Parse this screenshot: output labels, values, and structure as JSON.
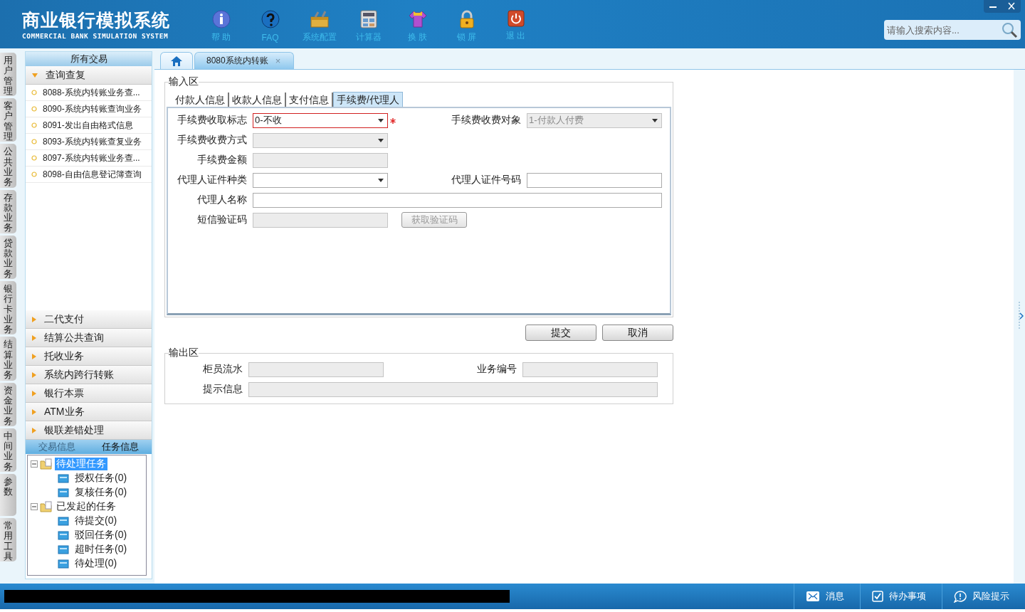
{
  "header": {
    "title": "商业银行模拟系统",
    "subtitle": "COMMERCIAL BANK SIMULATION SYSTEM",
    "nav": [
      {
        "kind": "info",
        "label": "帮 助"
      },
      {
        "kind": "faq",
        "label": "FAQ"
      },
      {
        "kind": "config",
        "label": "系统配置"
      },
      {
        "kind": "calculator",
        "label": "计算器"
      },
      {
        "kind": "skin",
        "label": "换 肤"
      },
      {
        "kind": "lock",
        "label": "锁 屏"
      },
      {
        "kind": "exit",
        "label": "退 出"
      }
    ],
    "search": {
      "placeholder": "请输入搜索内容..."
    }
  },
  "side_tabs": [
    {
      "label": "用户管理",
      "selected": false
    },
    {
      "label": "客户管理",
      "selected": false
    },
    {
      "label": "公共业务",
      "selected": false
    },
    {
      "label": "存款业务",
      "selected": false
    },
    {
      "label": "贷款业务",
      "selected": false
    },
    {
      "label": "银行卡业务",
      "selected": false
    },
    {
      "label": "结算业务",
      "selected": false
    },
    {
      "label": "资金业务",
      "selected": false
    },
    {
      "label": "中间业务",
      "selected": false
    },
    {
      "label": "参数",
      "selected": false
    },
    {
      "label": "常用工具",
      "selected": false
    }
  ],
  "sidebar": {
    "title": "所有交易",
    "groups": [
      {
        "label": "查询查复",
        "expanded": true,
        "items": [
          "8088-系统内转账业务查...",
          "8090-系统内转账查询业务",
          "8091-发出自由格式信息",
          "8093-系统内转账查复业务",
          "8097-系统内转账业务查...",
          "8098-自由信息登记簿查询"
        ]
      },
      {
        "label": "二代支付",
        "expanded": false
      },
      {
        "label": "结算公共查询",
        "expanded": false
      },
      {
        "label": "托收业务",
        "expanded": false
      },
      {
        "label": "系统内跨行转账",
        "expanded": false
      },
      {
        "label": "银行本票",
        "expanded": false
      },
      {
        "label": "ATM业务",
        "expanded": false
      },
      {
        "label": "银联差错处理",
        "expanded": false
      }
    ],
    "tabs": [
      {
        "label": "交易信息",
        "selected": false
      },
      {
        "label": "任务信息",
        "selected": true
      }
    ],
    "tree": [
      {
        "label": "待处理任务",
        "expanded": true,
        "selected": true,
        "children": [
          {
            "label": "授权任务(0)",
            "selected": false
          },
          {
            "label": "复核任务(0)",
            "selected": false
          }
        ]
      },
      {
        "label": "已发起的任务",
        "expanded": true,
        "selected": false,
        "children": [
          {
            "label": "待提交(0)",
            "selected": false
          },
          {
            "label": "驳回任务(0)",
            "selected": false
          },
          {
            "label": "超时任务(0)",
            "selected": false
          },
          {
            "label": "待处理(0)",
            "selected": false
          }
        ]
      }
    ]
  },
  "page_tabs": [
    {
      "kind": "home",
      "selected": false
    },
    {
      "kind": "page",
      "label": "8080系统内转账",
      "close": "×",
      "selected": true
    }
  ],
  "input_area": {
    "title": "输入区",
    "tabs": [
      {
        "label": "付款人信息",
        "selected": false
      },
      {
        "label": "收款人信息",
        "selected": false
      },
      {
        "label": "支付信息",
        "selected": false
      },
      {
        "label": "手续费/代理人",
        "selected": true
      }
    ],
    "rows": [
      [
        {
          "label": "手续费收取标志",
          "kind": "select",
          "value": "0-不收",
          "disabled": false,
          "required": true
        },
        {
          "label": "手续费收费对象",
          "kind": "select",
          "value": "1-付款人付费",
          "disabled": true,
          "required": false
        }
      ],
      [
        {
          "label": "手续费收费方式",
          "kind": "select",
          "disabled": true,
          "required": false
        }
      ],
      [
        {
          "label": "手续费金额",
          "kind": "text",
          "disabled": true,
          "required": false
        }
      ],
      [
        {
          "label": "代理人证件种类",
          "kind": "select",
          "disabled": false,
          "required": false
        },
        {
          "label": "代理人证件号码",
          "kind": "text",
          "disabled": false,
          "required": false
        }
      ],
      [
        {
          "label": "代理人名称",
          "kind": "long-text",
          "disabled": false,
          "required": false
        }
      ],
      [
        {
          "label": "短信验证码",
          "kind": "text",
          "disabled": true,
          "required": false
        },
        {
          "label": "获取验证码",
          "kind": "button",
          "disabled": true
        }
      ]
    ]
  },
  "buttons": [
    "提交",
    "取消"
  ],
  "output_area": {
    "title": "输出区",
    "rows": [
      [
        {
          "label": "柜员流水",
          "kind": "text",
          "disabled": true
        },
        {
          "label": "业务编号",
          "kind": "text",
          "disabled": true
        }
      ],
      [
        {
          "label": "提示信息",
          "kind": "long-text",
          "disabled": true
        }
      ]
    ]
  },
  "status_bar": [
    {
      "kind": "mail",
      "label": "消息"
    },
    {
      "kind": "check",
      "label": "待办事项"
    },
    {
      "kind": "alert",
      "label": "风险提示"
    }
  ]
}
